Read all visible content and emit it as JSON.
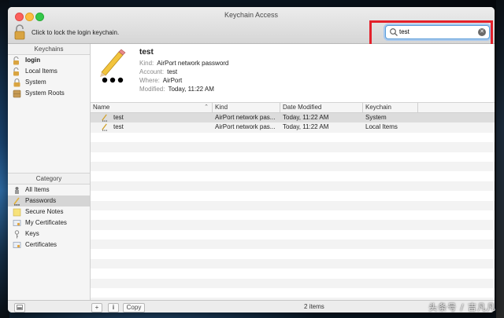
{
  "window": {
    "title": "Keychain Access"
  },
  "toolbar": {
    "lock_text": "Click to lock the login keychain."
  },
  "search": {
    "value": "test",
    "placeholder": "Search"
  },
  "sidebar": {
    "keychains_header": "Keychains",
    "keychains": [
      {
        "label": "login",
        "icon": "unlocked-lock-icon",
        "bold": true
      },
      {
        "label": "Local Items",
        "icon": "unlocked-lock-icon"
      },
      {
        "label": "System",
        "icon": "locked-lock-icon"
      },
      {
        "label": "System Roots",
        "icon": "cabinet-icon"
      }
    ],
    "category_header": "Category",
    "categories": [
      {
        "label": "All Items",
        "icon": "all-items-icon"
      },
      {
        "label": "Passwords",
        "icon": "password-pencil-icon",
        "selected": true
      },
      {
        "label": "Secure Notes",
        "icon": "note-icon"
      },
      {
        "label": "My Certificates",
        "icon": "certificate-icon"
      },
      {
        "label": "Keys",
        "icon": "key-icon"
      },
      {
        "label": "Certificates",
        "icon": "certificate-icon"
      }
    ]
  },
  "detail": {
    "name": "test",
    "kind_label": "Kind:",
    "kind": "AirPort network password",
    "account_label": "Account:",
    "account": "test",
    "where_label": "Where:",
    "where": "AirPort",
    "modified_label": "Modified:",
    "modified": "Today, 11:22 AM"
  },
  "table": {
    "columns": [
      "Name",
      "Kind",
      "Date Modified",
      "Keychain"
    ],
    "rows": [
      {
        "name": "test",
        "kind": "AirPort network pas...",
        "date": "Today, 11:22 AM",
        "keychain": "System"
      },
      {
        "name": "test",
        "kind": "AirPort network pas...",
        "date": "Today, 11:22 AM",
        "keychain": "Local Items"
      }
    ]
  },
  "bottom": {
    "add": "+",
    "info": "i",
    "copy": "Copy",
    "count": "2 items"
  },
  "watermark": "头条号 / 吉凡凡",
  "colors": {
    "highlight": "#e3212b",
    "focus_ring": "#5b9dd9",
    "selected_row": "#dcdcdc"
  }
}
